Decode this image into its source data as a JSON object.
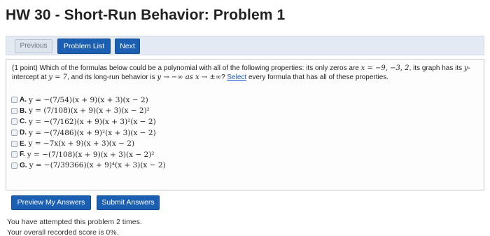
{
  "page_title": "HW 30 - Short-Run Behavior: Problem 1",
  "nav": {
    "previous": "Previous",
    "problem_list": "Problem List",
    "next": "Next"
  },
  "problem": {
    "prompt_start": "(1 point) Which of the formulas below could be a polynomial with all of the following properties: its only zeros are ",
    "zeros_math": "x = −9, −3, 2",
    "prompt_mid1": ", its graph has its ",
    "y_var": "y",
    "prompt_mid2": "-intercept at ",
    "intercept_math": "y = 7",
    "prompt_mid3": ", and its long-run behavior is ",
    "longrun_math": "y → −∞ as x → ±∞",
    "prompt_mid4": "? ",
    "select_link": "Select",
    "prompt_end": " every formula that has all of these properties.",
    "options": [
      {
        "letter": "A.",
        "formula": "y = −(7/54)(x + 9)(x + 3)(x − 2)"
      },
      {
        "letter": "B.",
        "formula": "y = (7/108)(x + 9)(x + 3)(x − 2)²"
      },
      {
        "letter": "C.",
        "formula": "y = −(7/162)(x + 9)(x + 3)²(x − 2)"
      },
      {
        "letter": "D.",
        "formula": "y = −(7/486)(x + 9)²(x + 3)(x − 2)"
      },
      {
        "letter": "E.",
        "formula": "y = −7x(x + 9)(x + 3)(x − 2)"
      },
      {
        "letter": "F.",
        "formula": "y = −(7/108)(x + 9)(x + 3)(x − 2)²"
      },
      {
        "letter": "G.",
        "formula": "y = −(7/39366)(x + 9)⁴(x + 3)(x − 2)"
      }
    ]
  },
  "actions": {
    "preview": "Preview My Answers",
    "submit": "Submit Answers"
  },
  "status": {
    "attempts": "You have attempted this problem 2 times.",
    "score": "Your overall recorded score is 0%."
  }
}
